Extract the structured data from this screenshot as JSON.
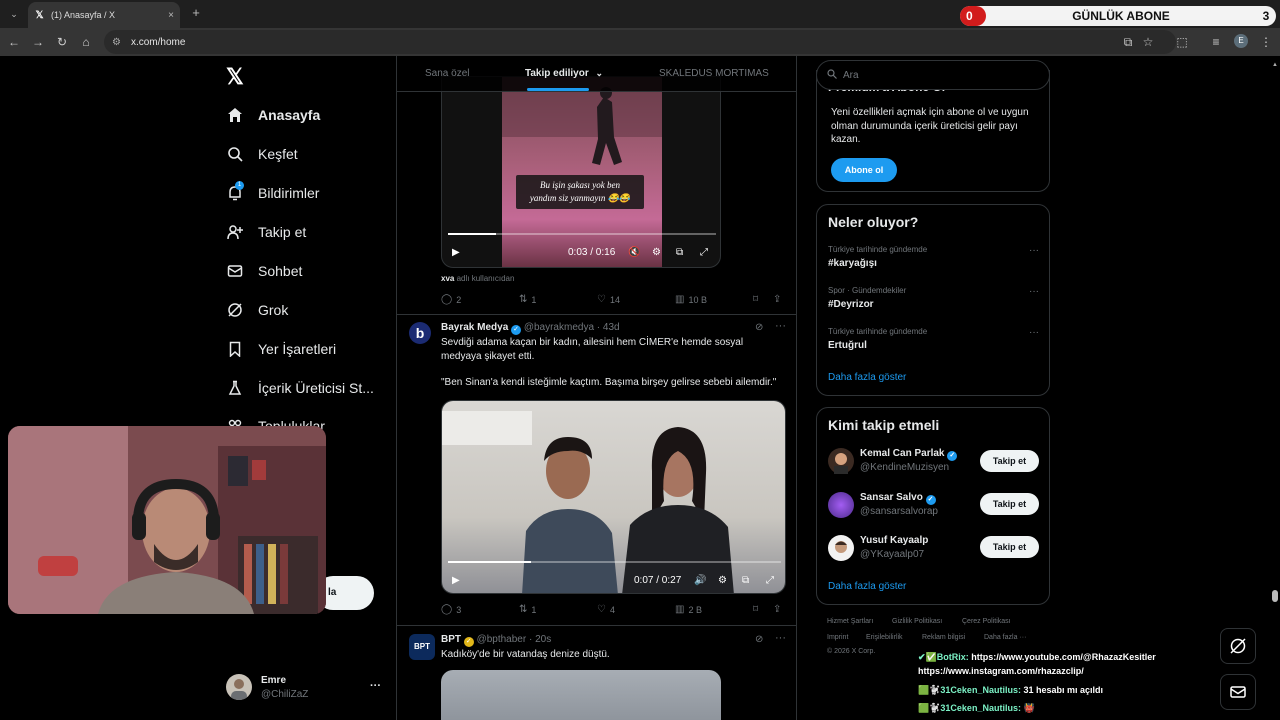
{
  "browser": {
    "tab_title": "(1) Anasayfa / X",
    "tab_close": "×",
    "new_tab": "+",
    "tabs_menu": "⌄",
    "url": "x.com/home",
    "profile_initial": "E"
  },
  "overlay": {
    "subscriber_widget": {
      "left_value": "0",
      "title": "GÜNLÜK ABONE",
      "right_value": "3"
    }
  },
  "nav": {
    "items": [
      {
        "label": "Anasayfa",
        "icon": "home-icon",
        "active": true
      },
      {
        "label": "Keşfet",
        "icon": "search-icon"
      },
      {
        "label": "Bildirimler",
        "icon": "bell-icon",
        "badge": "1"
      },
      {
        "label": "Takip et",
        "icon": "follow-icon"
      },
      {
        "label": "Sohbet",
        "icon": "mail-icon"
      },
      {
        "label": "Grok",
        "icon": "grok-icon"
      },
      {
        "label": "Yer İşaretleri",
        "icon": "bookmark-icon"
      },
      {
        "label": "İçerik Üreticisi St...",
        "icon": "creator-icon"
      },
      {
        "label": "Topluluklar",
        "icon": "communities-icon"
      }
    ],
    "post_button_partial": "la",
    "user": {
      "name": "Emre",
      "handle": "@ChiliZaZ",
      "more": "···"
    }
  },
  "feed": {
    "tabs": [
      {
        "label": "Sana özel"
      },
      {
        "label": "Takip ediliyor",
        "active": true
      },
      {
        "label": "SKALEDUS MORTIMAS"
      }
    ],
    "tweets": [
      {
        "video_caption_line1": "Bu işin şakası yok ben",
        "video_caption_line2": "yandım siz yanmayın 😂😂",
        "video_time": "0:03 / 0:16",
        "video_progress": 0.18,
        "source_user": "xva",
        "source_text": "adlı kullanıcıdan",
        "replies": "2",
        "reposts": "1",
        "likes": "14",
        "views": "10 B"
      },
      {
        "name": "Bayrak Medya",
        "handle": "@bayrakmedya",
        "time": "· 43d",
        "avatar_letter": "b",
        "text_line1": "Sevdiği adama kaçan bir kadın, ailesini hem CİMER'e hemde sosyal",
        "text_line2": "medyaya şikayet etti.",
        "quote": "\"Ben Sinan'a kendi isteğimle kaçtım. Başıma birşey gelirse sebebi ailemdir.\"",
        "video_time": "0:07 / 0:27",
        "video_progress": 0.25,
        "replies": "3",
        "reposts": "1",
        "likes": "4",
        "views": "2 B"
      },
      {
        "name": "BPT",
        "handle": "@bpthaber",
        "time": "· 20s",
        "avatar_text": "BPT",
        "text_line1": "Kadıköy'de bir vatandaş denize düştü."
      }
    ]
  },
  "right": {
    "search_placeholder": "Ara",
    "premium": {
      "title": "Premium'a Abone Ol",
      "desc_line1": "Yeni özellikleri açmak için abone ol ve uygun",
      "desc_line2": "olman durumunda içerik üreticisi gelir payı",
      "desc_line3": "kazan.",
      "button": "Abone ol"
    },
    "trends": {
      "title": "Neler oluyor?",
      "items": [
        {
          "meta": "Türkiye tarihinde gündemde",
          "name": "#karyağışı"
        },
        {
          "meta": "Spor · Gündemdekiler",
          "name": "#Deyrizor"
        },
        {
          "meta": "Türkiye tarihinde gündemde",
          "name": "Ertuğrul"
        }
      ],
      "show_more": "Daha fazla göster"
    },
    "who_to_follow": {
      "title": "Kimi takip etmeli",
      "users": [
        {
          "name": "Kemal Can Parlak",
          "handle": "@KendineMuzisyen",
          "button": "Takip et"
        },
        {
          "name": "Sansar Salvo",
          "handle": "@sansarsalvorap",
          "button": "Takip et"
        },
        {
          "name": "Yusuf Kayaalp",
          "handle": "@YKayaalp07",
          "button": "Takip et"
        }
      ],
      "show_more": "Daha fazla göster"
    },
    "footer": {
      "links": [
        "Hizmet Şartları",
        "Gizlilik Politikası",
        "Çerez Politikası",
        "Imprint",
        "Erişilebilirlik",
        "Reklam bilgisi",
        "Daha fazla ···"
      ],
      "copyright": "© 2026 X Corp."
    }
  },
  "chat": {
    "lines": [
      {
        "user": "✔✅BotRix:",
        "text": " https://www.youtube.com/@RhazazKesitler"
      },
      {
        "user": "",
        "text": "https://www.instagram.com/rhazazclip/"
      },
      {
        "user": "🟩🐩31Ceken_Nautilus:",
        "text": " 31 hesabı mı açıldı"
      },
      {
        "user": "🟩🐩31Ceken_Nautilus:",
        "text": " 👹"
      }
    ]
  },
  "colors": {
    "accent": "#1d9bf0",
    "background": "#000000",
    "border": "#2f3336",
    "muted": "#71767b",
    "widget_red": "#d21c1c"
  }
}
